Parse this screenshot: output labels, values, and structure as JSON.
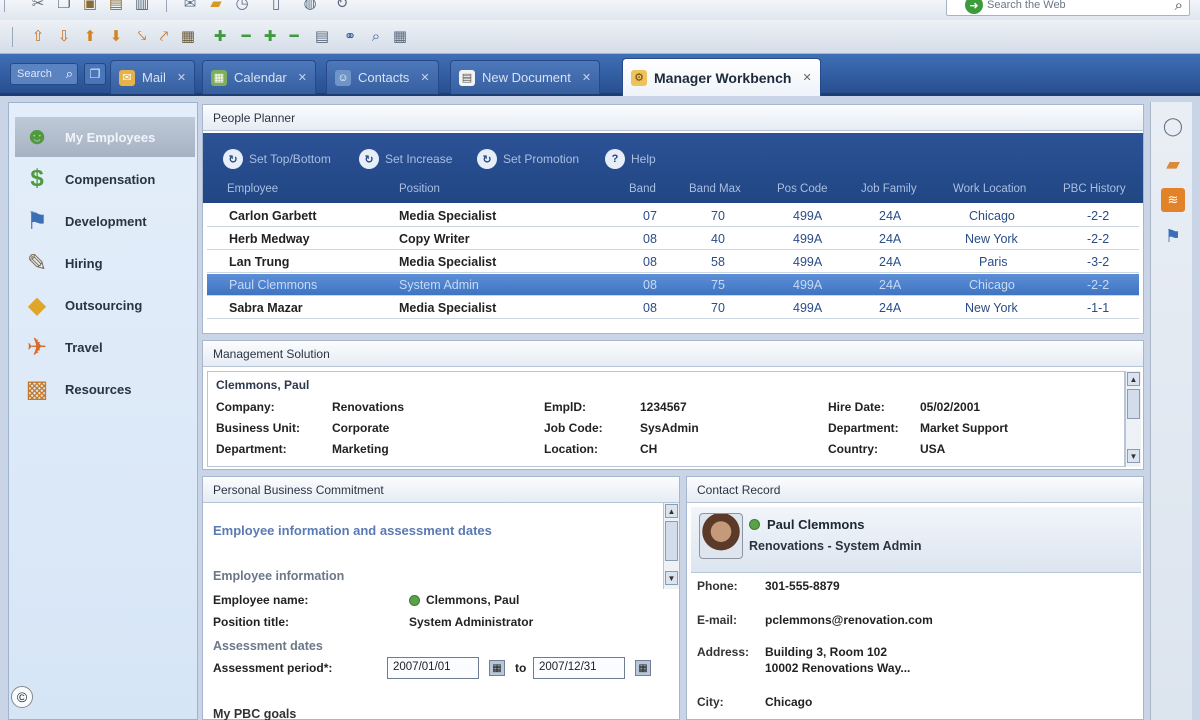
{
  "toolbar": {
    "row1_icons": [
      "cut-icon",
      "copy-icon",
      "paste-icon",
      "print-icon",
      "save-icon",
      "mail-icon",
      "folder-icon",
      "clock-icon",
      "new-doc-icon",
      "globe-icon",
      "refresh-icon"
    ],
    "row2_icons": [
      "promote-icon",
      "demote-icon",
      "move-up-icon",
      "move-down-icon",
      "indent-icon",
      "outdent-icon",
      "table-icon",
      "add-icon",
      "remove-icon",
      "expand-icon",
      "collapse-icon",
      "page-icon",
      "binoculars-icon",
      "find-icon",
      "grid-icon"
    ],
    "web_search": {
      "placeholder": "Search the Web"
    }
  },
  "tabs": {
    "search_box": "Search",
    "items": [
      {
        "label": "Mail",
        "icon": "mail-icon"
      },
      {
        "label": "Calendar",
        "icon": "calendar-icon"
      },
      {
        "label": "Contacts",
        "icon": "contacts-icon"
      },
      {
        "label": "New Document",
        "icon": "document-icon"
      },
      {
        "label": "Manager Workbench",
        "icon": "workbench-icon"
      }
    ]
  },
  "sidebar": {
    "items": [
      {
        "label": "My Employees",
        "icon": "employees-icon"
      },
      {
        "label": "Compensation",
        "icon": "compensation-icon"
      },
      {
        "label": "Development",
        "icon": "development-icon"
      },
      {
        "label": "Hiring",
        "icon": "hiring-icon"
      },
      {
        "label": "Outsourcing",
        "icon": "outsourcing-icon"
      },
      {
        "label": "Travel",
        "icon": "travel-icon"
      },
      {
        "label": "Resources",
        "icon": "resources-icon"
      }
    ]
  },
  "people_planner": {
    "title": "People Planner",
    "actions": [
      {
        "label": "Set Top/Bottom",
        "icon": "refresh-icon"
      },
      {
        "label": "Set Increase",
        "icon": "refresh-icon"
      },
      {
        "label": "Set Promotion",
        "icon": "refresh-icon"
      },
      {
        "label": "Help",
        "icon": "help-icon"
      }
    ],
    "columns": [
      "Employee",
      "Position",
      "Band",
      "Band Max",
      "Pos Code",
      "Job Family",
      "Work Location",
      "PBC History"
    ],
    "rows": [
      [
        "Carlon Garbett",
        "Media Specialist",
        "07",
        "70",
        "499A",
        "24A",
        "Chicago",
        "-2-2"
      ],
      [
        "Herb Medway",
        "Copy Writer",
        "08",
        "40",
        "499A",
        "24A",
        "New York",
        "-2-2"
      ],
      [
        "Lan Trung",
        "Media Specialist",
        "08",
        "58",
        "499A",
        "24A",
        "Paris",
        "-3-2"
      ],
      [
        "Paul Clemmons",
        "System Admin",
        "08",
        "75",
        "499A",
        "24A",
        "Chicago",
        "-2-2"
      ],
      [
        "Sabra Mazar",
        "Media Specialist",
        "08",
        "70",
        "499A",
        "24A",
        "New York",
        "-1-1"
      ]
    ]
  },
  "management_solution": {
    "title": "Management Solution",
    "name": "Clemmons, Paul",
    "fields": [
      {
        "label": "Company:",
        "value": "Renovations"
      },
      {
        "label": "Business Unit:",
        "value": "Corporate"
      },
      {
        "label": "Department:",
        "value": "Marketing"
      },
      {
        "label": "EmplD:",
        "value": "1234567"
      },
      {
        "label": "Job Code:",
        "value": "SysAdmin"
      },
      {
        "label": "Location:",
        "value": "CH"
      },
      {
        "label": "Hire Date:",
        "value": "05/02/2001"
      },
      {
        "label": "Department:",
        "value": "Market Support"
      },
      {
        "label": "Country:",
        "value": "USA"
      }
    ]
  },
  "pbc": {
    "title": "Personal Business Commitment",
    "heading": "Employee information and assessment dates",
    "section_info": "Employee information",
    "employee_name_label": "Employee name:",
    "employee_name": "Clemmons, Paul",
    "position_label": "Position title:",
    "position": "System Administrator",
    "section_dates": "Assessment dates",
    "period_label": "Assessment period*:",
    "date_from": "2007/01/01",
    "to_label": "to",
    "date_to": "2007/12/31",
    "goals_label": "My PBC goals"
  },
  "contact_record": {
    "title": "Contact Record",
    "name": "Paul Clemmons",
    "subtitle": "Renovations - System Admin",
    "phone_label": "Phone:",
    "phone": "301-555-8879",
    "email_label": "E-mail:",
    "email": "pclemmons@renovation.com",
    "address_label": "Address:",
    "address_1": "Building 3, Room 102",
    "address_2": "10002 Renovations Way...",
    "city_label": "City:",
    "city": "Chicago"
  },
  "watermark": "©",
  "colors": {
    "accent": "#2c5297",
    "selection": "#4a80cc",
    "status_online": "#5aa24a"
  }
}
